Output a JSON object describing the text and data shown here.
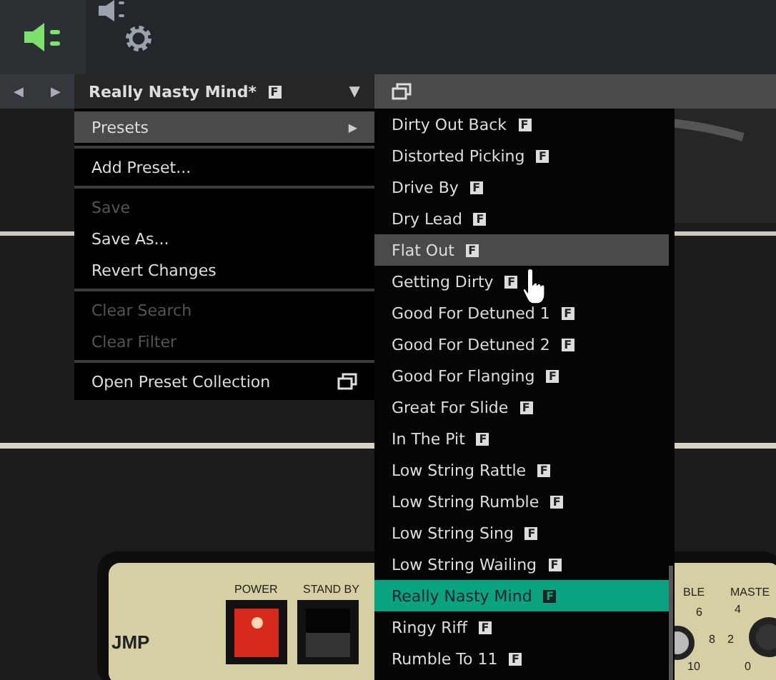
{
  "toolbar": {
    "tabs": [
      {
        "kind": "plug",
        "selected": true
      },
      {
        "kind": "speaker-gear",
        "selected": false
      }
    ]
  },
  "preset_bar": {
    "back": "◀",
    "forward": "▶",
    "name": "Really Nasty Mind*",
    "badge": "F",
    "dropdown": "▼"
  },
  "menu": {
    "items": [
      {
        "kind": "submenu",
        "label": "Presets",
        "arrow": "▶",
        "highlighted": true,
        "disabled": false
      },
      {
        "kind": "separator"
      },
      {
        "kind": "item",
        "label": "Add Preset...",
        "highlighted": false,
        "disabled": false
      },
      {
        "kind": "separator"
      },
      {
        "kind": "item",
        "label": "Save",
        "highlighted": false,
        "disabled": true
      },
      {
        "kind": "item",
        "label": "Save As...",
        "highlighted": false,
        "disabled": false
      },
      {
        "kind": "item",
        "label": "Revert Changes",
        "highlighted": false,
        "disabled": false
      },
      {
        "kind": "separator"
      },
      {
        "kind": "item",
        "label": "Clear Search",
        "highlighted": false,
        "disabled": true
      },
      {
        "kind": "item",
        "label": "Clear Filter",
        "highlighted": false,
        "disabled": true
      },
      {
        "kind": "separator"
      },
      {
        "kind": "window",
        "label": "Open Preset Collection",
        "highlighted": false,
        "disabled": false
      }
    ]
  },
  "submenu": {
    "items": [
      {
        "label": "Dirty Out Back",
        "badge": "F",
        "selected": false,
        "hovered": false
      },
      {
        "label": "Distorted Picking",
        "badge": "F",
        "selected": false,
        "hovered": false
      },
      {
        "label": "Drive By",
        "badge": "F",
        "selected": false,
        "hovered": false
      },
      {
        "label": "Dry Lead",
        "badge": "F",
        "selected": false,
        "hovered": false
      },
      {
        "label": "Flat Out",
        "badge": "F",
        "selected": false,
        "hovered": true
      },
      {
        "label": "Getting Dirty",
        "badge": "F",
        "selected": false,
        "hovered": false
      },
      {
        "label": "Good For Detuned 1",
        "badge": "F",
        "selected": false,
        "hovered": false
      },
      {
        "label": "Good For Detuned 2",
        "badge": "F",
        "selected": false,
        "hovered": false
      },
      {
        "label": "Good For Flanging",
        "badge": "F",
        "selected": false,
        "hovered": false
      },
      {
        "label": "Great For Slide",
        "badge": "F",
        "selected": false,
        "hovered": false
      },
      {
        "label": "In The Pit",
        "badge": "F",
        "selected": false,
        "hovered": false
      },
      {
        "label": "Low String Rattle",
        "badge": "F",
        "selected": false,
        "hovered": false
      },
      {
        "label": "Low String Rumble",
        "badge": "F",
        "selected": false,
        "hovered": false
      },
      {
        "label": "Low String Sing",
        "badge": "F",
        "selected": false,
        "hovered": false
      },
      {
        "label": "Low String Wailing",
        "badge": "F",
        "selected": false,
        "hovered": false
      },
      {
        "label": "Really Nasty Mind",
        "badge": "F",
        "selected": true,
        "hovered": false
      },
      {
        "label": "Ringy Riff",
        "badge": "F",
        "selected": false,
        "hovered": false
      },
      {
        "label": "Rumble To 11",
        "badge": "F",
        "selected": false,
        "hovered": false
      }
    ]
  },
  "amp": {
    "labels": [
      {
        "kind": "power",
        "text": "POWER"
      },
      {
        "kind": "standby",
        "text": "STAND BY"
      },
      {
        "kind": "model",
        "text": "JMP"
      },
      {
        "kind": "treble",
        "text": "BLE"
      },
      {
        "kind": "master",
        "text": "MASTE"
      },
      {
        "kind": "t6",
        "text": "6"
      },
      {
        "kind": "t8",
        "text": "8"
      },
      {
        "kind": "t10",
        "text": "10"
      },
      {
        "kind": "m4",
        "text": "4"
      },
      {
        "kind": "m2",
        "text": "2"
      },
      {
        "kind": "m0",
        "text": "0"
      }
    ]
  }
}
